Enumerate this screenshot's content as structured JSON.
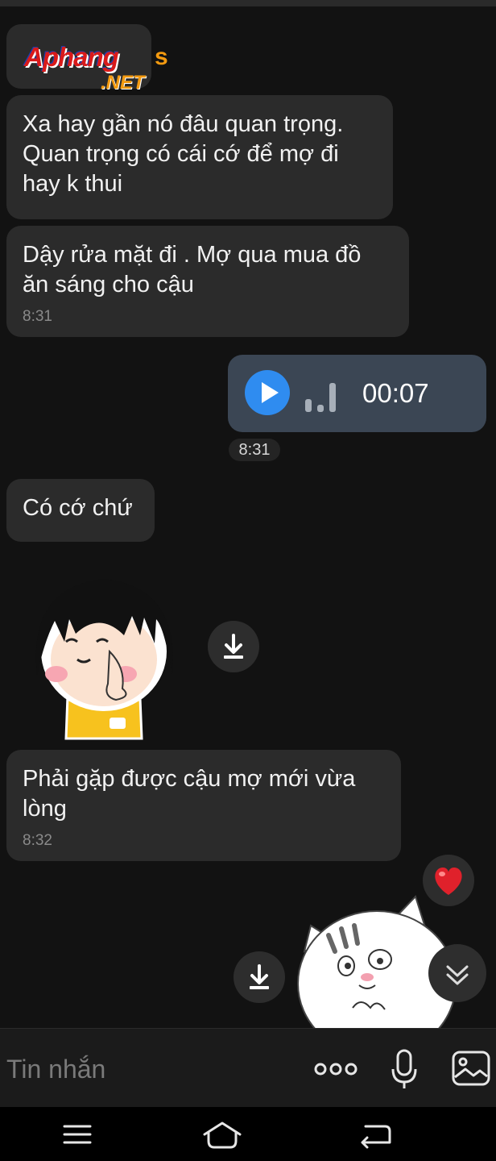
{
  "watermark": {
    "main": "Aphang",
    "suffix": "s",
    "net": ".NET"
  },
  "messages": [
    {
      "text": "Xa hay gần nó đâu quan trọng.\nQuan trọng có cái cớ để mợ đi\nhay k thui"
    },
    {
      "text": "Dậy rửa mặt đi . Mợ qua mua đồ\năn sáng cho cậu",
      "time": "8:31"
    },
    {
      "text": "Có cớ chứ"
    },
    {
      "text": "Phải gặp được cậu mợ mới vừa\nlòng",
      "time": "8:32"
    }
  ],
  "voice_message": {
    "duration": "00:07",
    "time": "8:31",
    "icon": "play-icon",
    "accent": "#2f8cf0"
  },
  "stickers": [
    {
      "icon": "girl-sticker",
      "action_icon": "download-icon"
    },
    {
      "icon": "cat-sticker",
      "action_icon": "download-icon"
    }
  ],
  "reaction": {
    "icon": "heart-icon",
    "color": "#e0212b"
  },
  "scroll_down": {
    "icon": "double-chevron-down-icon"
  },
  "composer": {
    "placeholder": "Tin nhắn",
    "icons": [
      "more-icon",
      "microphone-icon",
      "image-icon"
    ]
  },
  "system_nav": {
    "icons": [
      "menu-icon",
      "home-icon",
      "back-icon"
    ]
  }
}
